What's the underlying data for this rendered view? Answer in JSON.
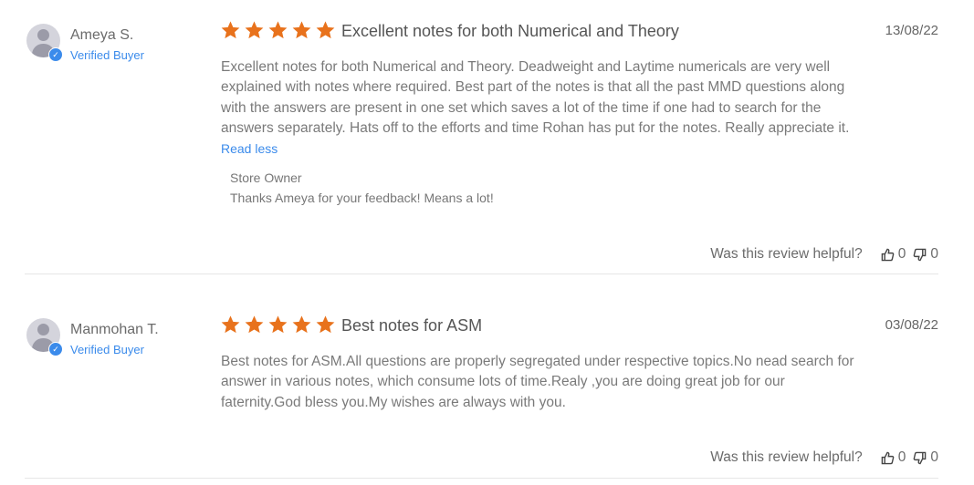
{
  "colors": {
    "star": "#e8721c",
    "link": "#3b8beb",
    "divider": "#e6e6e6"
  },
  "reviews": [
    {
      "author": "Ameya S.",
      "verified": "Verified Buyer",
      "rating": 5,
      "title": "Excellent notes for both Numerical and Theory",
      "date": "13/08/22",
      "body": "Excellent notes for both Numerical and Theory. Deadweight and Laytime numericals are very well explained with notes where required. Best part of the notes is that all the past MMD questions along with the answers are present in one set which saves a lot of the time if one had to search for the answers separately. Hats off to the efforts and time Rohan has put for the notes. Really appreciate it.",
      "read_less": "Read less",
      "reply_author": "Store Owner",
      "reply_text": "Thanks Ameya for your feedback! Means a lot!",
      "helpful_label": "Was this review helpful?",
      "upvotes": "0",
      "downvotes": "0"
    },
    {
      "author": "Manmohan T.",
      "verified": "Verified Buyer",
      "rating": 5,
      "title": "Best notes for ASM",
      "date": "03/08/22",
      "body": "Best notes for ASM.All questions are properly segregated under respective topics.No nead search for answer in various notes, which consume lots of time.Realy ,you are doing great job for our faternity.God bless you.My wishes are always with you.",
      "helpful_label": "Was this review helpful?",
      "upvotes": "0",
      "downvotes": "0"
    }
  ]
}
